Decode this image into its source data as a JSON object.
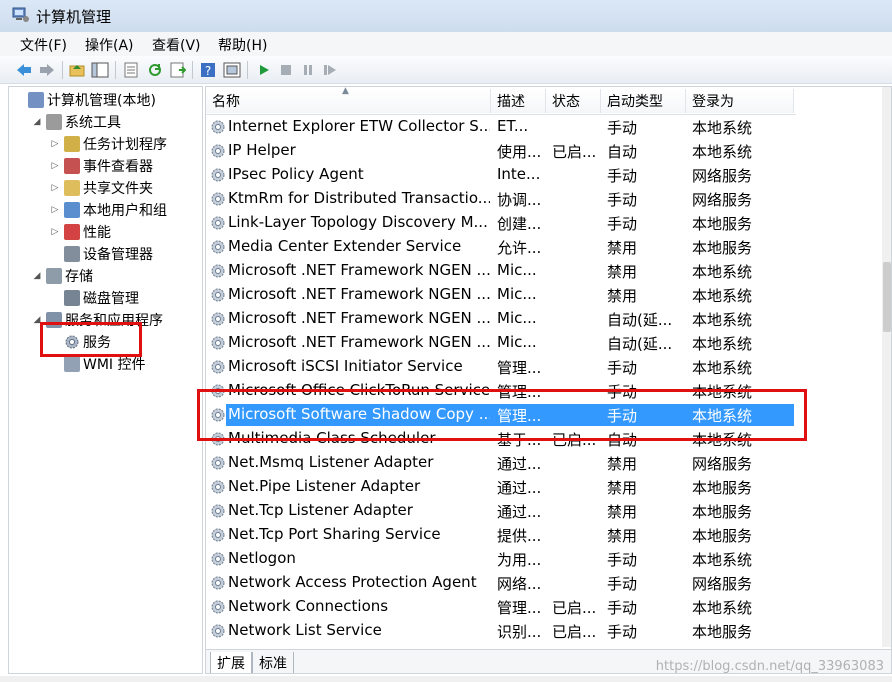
{
  "window": {
    "title": "计算机管理"
  },
  "menu": [
    "文件(F)",
    "操作(A)",
    "查看(V)",
    "帮助(H)"
  ],
  "toolbar_icons": [
    "back-arrow-icon",
    "forward-arrow-icon",
    "up-folder-icon",
    "show-tree-icon",
    "export-list-icon",
    "refresh-icon",
    "properties-icon",
    "help-icon",
    "console-icon",
    "play-icon",
    "stop-icon",
    "pause-icon",
    "resume-icon"
  ],
  "tree": [
    {
      "label": "计算机管理(本地)",
      "level": 0,
      "arrow": "",
      "icon": "computer-icon"
    },
    {
      "label": "系统工具",
      "level": 1,
      "arrow": "◢",
      "icon": "tools-icon"
    },
    {
      "label": "任务计划程序",
      "level": 2,
      "arrow": "▷",
      "icon": "clock-icon"
    },
    {
      "label": "事件查看器",
      "level": 2,
      "arrow": "▷",
      "icon": "event-log-icon"
    },
    {
      "label": "共享文件夹",
      "level": 2,
      "arrow": "▷",
      "icon": "shared-folder-icon"
    },
    {
      "label": "本地用户和组",
      "level": 2,
      "arrow": "▷",
      "icon": "users-icon"
    },
    {
      "label": "性能",
      "level": 2,
      "arrow": "▷",
      "icon": "performance-icon"
    },
    {
      "label": "设备管理器",
      "level": 2,
      "arrow": "",
      "icon": "device-manager-icon"
    },
    {
      "label": "存储",
      "level": 1,
      "arrow": "◢",
      "icon": "storage-icon"
    },
    {
      "label": "磁盘管理",
      "level": 2,
      "arrow": "",
      "icon": "disk-icon"
    },
    {
      "label": "服务和应用程序",
      "level": 1,
      "arrow": "◢",
      "icon": "services-apps-icon"
    },
    {
      "label": "服务",
      "level": 2,
      "arrow": "",
      "icon": "gear-icon"
    },
    {
      "label": "WMI 控件",
      "level": 2,
      "arrow": "",
      "icon": "wmi-icon"
    }
  ],
  "columns": [
    "名称",
    "描述",
    "状态",
    "启动类型",
    "登录为"
  ],
  "services": [
    {
      "name": "Internet Explorer ETW Collector S...",
      "desc": "ET...",
      "status": "",
      "startup": "手动",
      "logon": "本地系统"
    },
    {
      "name": "IP Helper",
      "desc": "使用...",
      "status": "已启...",
      "startup": "自动",
      "logon": "本地系统"
    },
    {
      "name": "IPsec Policy Agent",
      "desc": "Inte...",
      "status": "",
      "startup": "手动",
      "logon": "网络服务"
    },
    {
      "name": "KtmRm for Distributed Transactio...",
      "desc": "协调...",
      "status": "",
      "startup": "手动",
      "logon": "网络服务"
    },
    {
      "name": "Link-Layer Topology Discovery M...",
      "desc": "创建...",
      "status": "",
      "startup": "手动",
      "logon": "本地服务"
    },
    {
      "name": "Media Center Extender Service",
      "desc": "允许...",
      "status": "",
      "startup": "禁用",
      "logon": "本地服务"
    },
    {
      "name": "Microsoft .NET Framework NGEN ...",
      "desc": "Mic...",
      "status": "",
      "startup": "禁用",
      "logon": "本地系统"
    },
    {
      "name": "Microsoft .NET Framework NGEN ...",
      "desc": "Mic...",
      "status": "",
      "startup": "禁用",
      "logon": "本地系统"
    },
    {
      "name": "Microsoft .NET Framework NGEN ...",
      "desc": "Mic...",
      "status": "",
      "startup": "自动(延...",
      "logon": "本地系统"
    },
    {
      "name": "Microsoft .NET Framework NGEN ...",
      "desc": "Mic...",
      "status": "",
      "startup": "自动(延...",
      "logon": "本地系统"
    },
    {
      "name": "Microsoft iSCSI Initiator Service",
      "desc": "管理...",
      "status": "",
      "startup": "手动",
      "logon": "本地系统"
    },
    {
      "name": "Microsoft Office ClickToRun Service",
      "desc": "管理...",
      "status": "",
      "startup": "手动",
      "logon": "本地系统"
    },
    {
      "name": "Microsoft Software Shadow Copy ...",
      "desc": "管理...",
      "status": "",
      "startup": "手动",
      "logon": "本地系统",
      "selected": true
    },
    {
      "name": "Multimedia Class Scheduler",
      "desc": "基于...",
      "status": "已启...",
      "startup": "自动",
      "logon": "本地系统"
    },
    {
      "name": "Net.Msmq Listener Adapter",
      "desc": "通过...",
      "status": "",
      "startup": "禁用",
      "logon": "网络服务"
    },
    {
      "name": "Net.Pipe Listener Adapter",
      "desc": "通过...",
      "status": "",
      "startup": "禁用",
      "logon": "本地服务"
    },
    {
      "name": "Net.Tcp Listener Adapter",
      "desc": "通过...",
      "status": "",
      "startup": "禁用",
      "logon": "本地服务"
    },
    {
      "name": "Net.Tcp Port Sharing Service",
      "desc": "提供...",
      "status": "",
      "startup": "禁用",
      "logon": "本地服务"
    },
    {
      "name": "Netlogon",
      "desc": "为用...",
      "status": "",
      "startup": "手动",
      "logon": "本地系统"
    },
    {
      "name": "Network Access Protection Agent",
      "desc": "网络...",
      "status": "",
      "startup": "手动",
      "logon": "网络服务"
    },
    {
      "name": "Network Connections",
      "desc": "管理...",
      "status": "已启...",
      "startup": "手动",
      "logon": "本地系统"
    },
    {
      "name": "Network List Service",
      "desc": "识别...",
      "status": "已启...",
      "startup": "手动",
      "logon": "本地服务"
    }
  ],
  "tabs": [
    "扩展",
    "标准"
  ],
  "watermark": "https://blog.csdn.net/qq_33963083",
  "colors": {
    "selection": "#3399ff",
    "highlight_box": "#e01010"
  }
}
